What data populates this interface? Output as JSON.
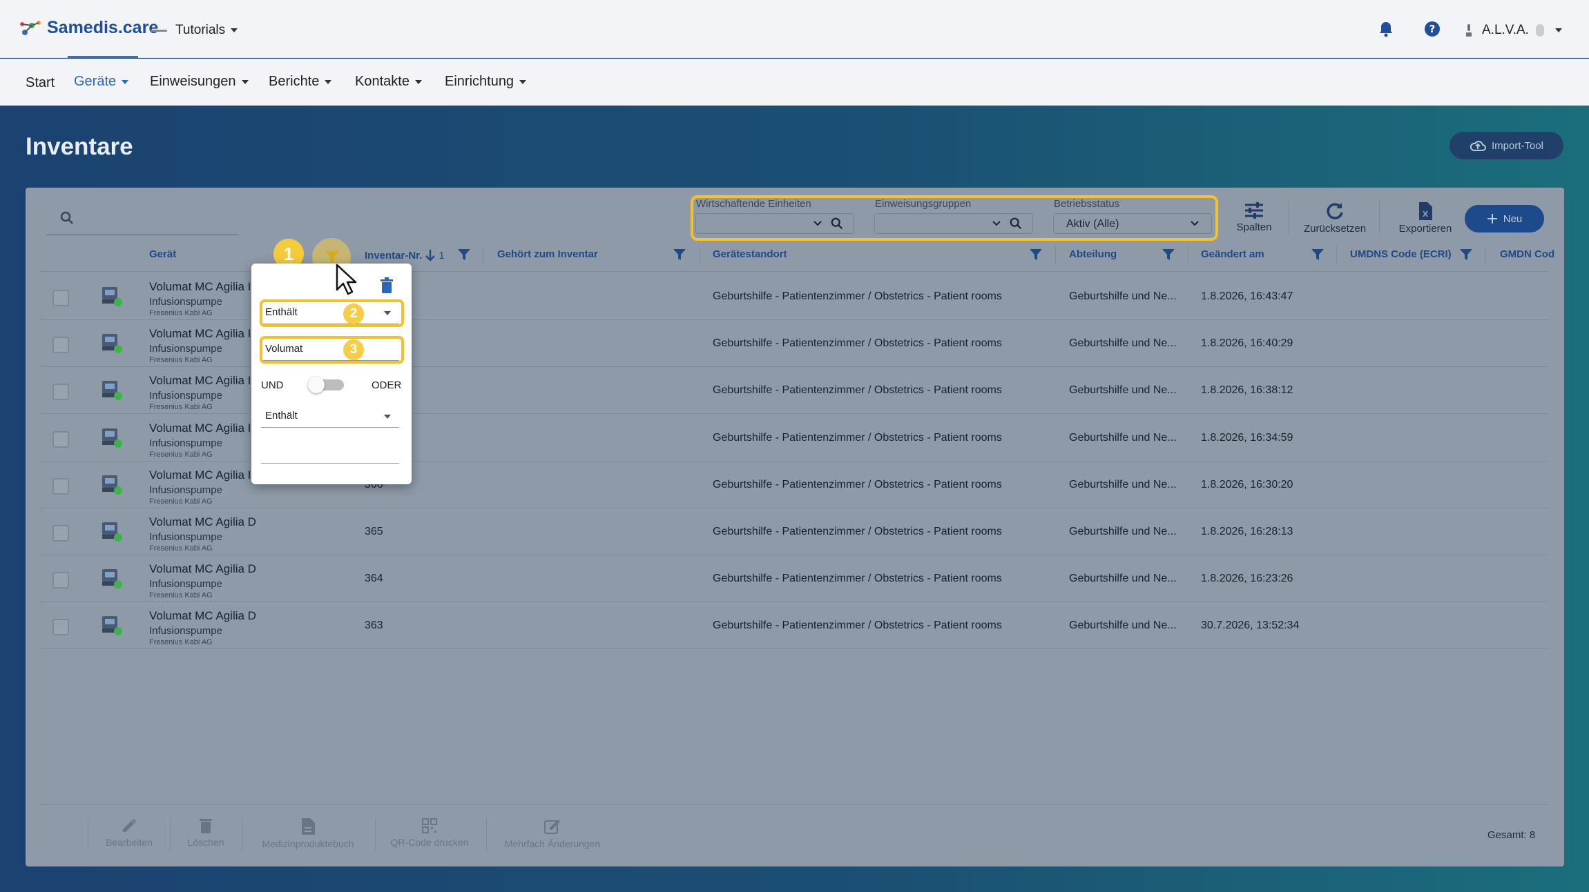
{
  "app": {
    "brand": "Samedis.care",
    "workspace": "Tutorials",
    "user": "A.L.V.A."
  },
  "nav": {
    "items": [
      {
        "label": "Start"
      },
      {
        "label": "Geräte"
      },
      {
        "label": "Einweisungen"
      },
      {
        "label": "Berichte"
      },
      {
        "label": "Kontakte"
      },
      {
        "label": "Einrichtung"
      }
    ]
  },
  "page": {
    "title": "Inventare",
    "import_label": "Import-Tool"
  },
  "search": {
    "placeholder": "",
    "value": ""
  },
  "filters": {
    "wirtschaftende_label": "Wirtschaftende Einheiten",
    "wirtschaftende_value": "",
    "einweisung_label": "Einweisungsgruppen",
    "einweisung_value": "",
    "betrieb_label": "Betriebsstatus",
    "betrieb_value": "Aktiv (Alle)"
  },
  "toolbar": {
    "columns": "Spalten",
    "reset": "Zurücksetzen",
    "export": "Exportieren",
    "new": "Neu"
  },
  "columns": {
    "geraet": "Gerät",
    "inventar": "Inventar-Nr.",
    "inventar_sort": "1",
    "gehoert": "Gehört zum Inventar",
    "standort": "Gerätestandort",
    "abteilung": "Abteilung",
    "geaendert": "Geändert am",
    "umdns": "UMDNS Code (ECRI)",
    "gmdn": "GMDN Cod"
  },
  "rows": [
    {
      "name": "Volumat MC Agilia I",
      "type": "Infusionspumpe",
      "maker": "Fresenius Kabi AG",
      "inv": "",
      "loc": "Geburtshilfe - Patientenzimmer / Obstetrics - Patient rooms",
      "dept": "Geburtshilfe und Ne...",
      "date": "1.8.2026, 16:43:47"
    },
    {
      "name": "Volumat MC Agilia I",
      "type": "Infusionspumpe",
      "maker": "Fresenius Kabi AG",
      "inv": "",
      "loc": "Geburtshilfe - Patientenzimmer / Obstetrics - Patient rooms",
      "dept": "Geburtshilfe und Ne...",
      "date": "1.8.2026, 16:40:29"
    },
    {
      "name": "Volumat MC Agilia I",
      "type": "Infusionspumpe",
      "maker": "Fresenius Kabi AG",
      "inv": "",
      "loc": "Geburtshilfe - Patientenzimmer / Obstetrics - Patient rooms",
      "dept": "Geburtshilfe und Ne...",
      "date": "1.8.2026, 16:38:12"
    },
    {
      "name": "Volumat MC Agilia I",
      "type": "Infusionspumpe",
      "maker": "Fresenius Kabi AG",
      "inv": "",
      "loc": "Geburtshilfe - Patientenzimmer / Obstetrics - Patient rooms",
      "dept": "Geburtshilfe und Ne...",
      "date": "1.8.2026, 16:34:59"
    },
    {
      "name": "Volumat MC Agilia I",
      "type": "Infusionspumpe",
      "maker": "Fresenius Kabi AG",
      "inv": "366",
      "loc": "Geburtshilfe - Patientenzimmer / Obstetrics - Patient rooms",
      "dept": "Geburtshilfe und Ne...",
      "date": "1.8.2026, 16:30:20"
    },
    {
      "name": "Volumat MC Agilia D",
      "type": "Infusionspumpe",
      "maker": "Fresenius Kabi AG",
      "inv": "365",
      "loc": "Geburtshilfe - Patientenzimmer / Obstetrics - Patient rooms",
      "dept": "Geburtshilfe und Ne...",
      "date": "1.8.2026, 16:28:13"
    },
    {
      "name": "Volumat MC Agilia D",
      "type": "Infusionspumpe",
      "maker": "Fresenius Kabi AG",
      "inv": "364",
      "loc": "Geburtshilfe - Patientenzimmer / Obstetrics - Patient rooms",
      "dept": "Geburtshilfe und Ne...",
      "date": "1.8.2026, 16:23:26"
    },
    {
      "name": "Volumat MC Agilia D",
      "type": "Infusionspumpe",
      "maker": "Fresenius Kabi AG",
      "inv": "363",
      "loc": "Geburtshilfe - Patientenzimmer / Obstetrics - Patient rooms",
      "dept": "Geburtshilfe und Ne...",
      "date": "30.7.2026, 13:52:34"
    }
  ],
  "bottom": {
    "edit": "Bearbeiten",
    "delete": "Löschen",
    "book": "Medizinproduktebuch",
    "qr": "QR-Code drucken",
    "multi": "Mehrfach Änderungen",
    "total": "Gesamt: 8"
  },
  "popup": {
    "op1": "Enthält",
    "value1": "Volumat",
    "and_label": "UND",
    "or_label": "ODER",
    "op2": "Enthält",
    "value2": ""
  },
  "badges": {
    "one": "1",
    "two": "2",
    "three": "3"
  },
  "colors": {
    "accent": "#2c66b8",
    "highlight": "#f3c12e",
    "badge": "#f6cd47",
    "status_dot": "#3db34a"
  },
  "icons": [
    "bell-icon",
    "help-icon",
    "search-icon",
    "filter-icon",
    "trash-icon",
    "sort-down-arrow-icon",
    "cloud-upload-icon",
    "sliders-icon",
    "refresh-icon",
    "excel-file-icon",
    "plus-icon",
    "edit-icon",
    "qr-code-icon",
    "book-icon",
    "device-icon",
    "cursor-icon"
  ]
}
